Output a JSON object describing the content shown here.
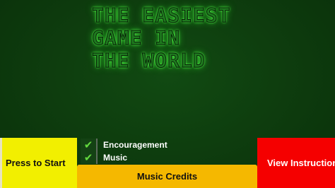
{
  "title": {
    "lines": [
      "THE EASIEST",
      "GAME IN",
      "THE WORLD"
    ]
  },
  "buttons": {
    "start_label": "Press to Start",
    "instructions_label": "View Instructions",
    "credits_label": "Music Credits"
  },
  "options": [
    {
      "label": "Encouragement",
      "checked": true,
      "icon": "check-icon"
    },
    {
      "label": "Music",
      "checked": true,
      "icon": "check-icon"
    }
  ],
  "colors": {
    "background": "#0d3a0d",
    "title_glow": "#3fe83a",
    "start_button": "#f2ef00",
    "instructions_button": "#f50000",
    "credits_button": "#f5b800",
    "checkmark": "#63d93e"
  }
}
